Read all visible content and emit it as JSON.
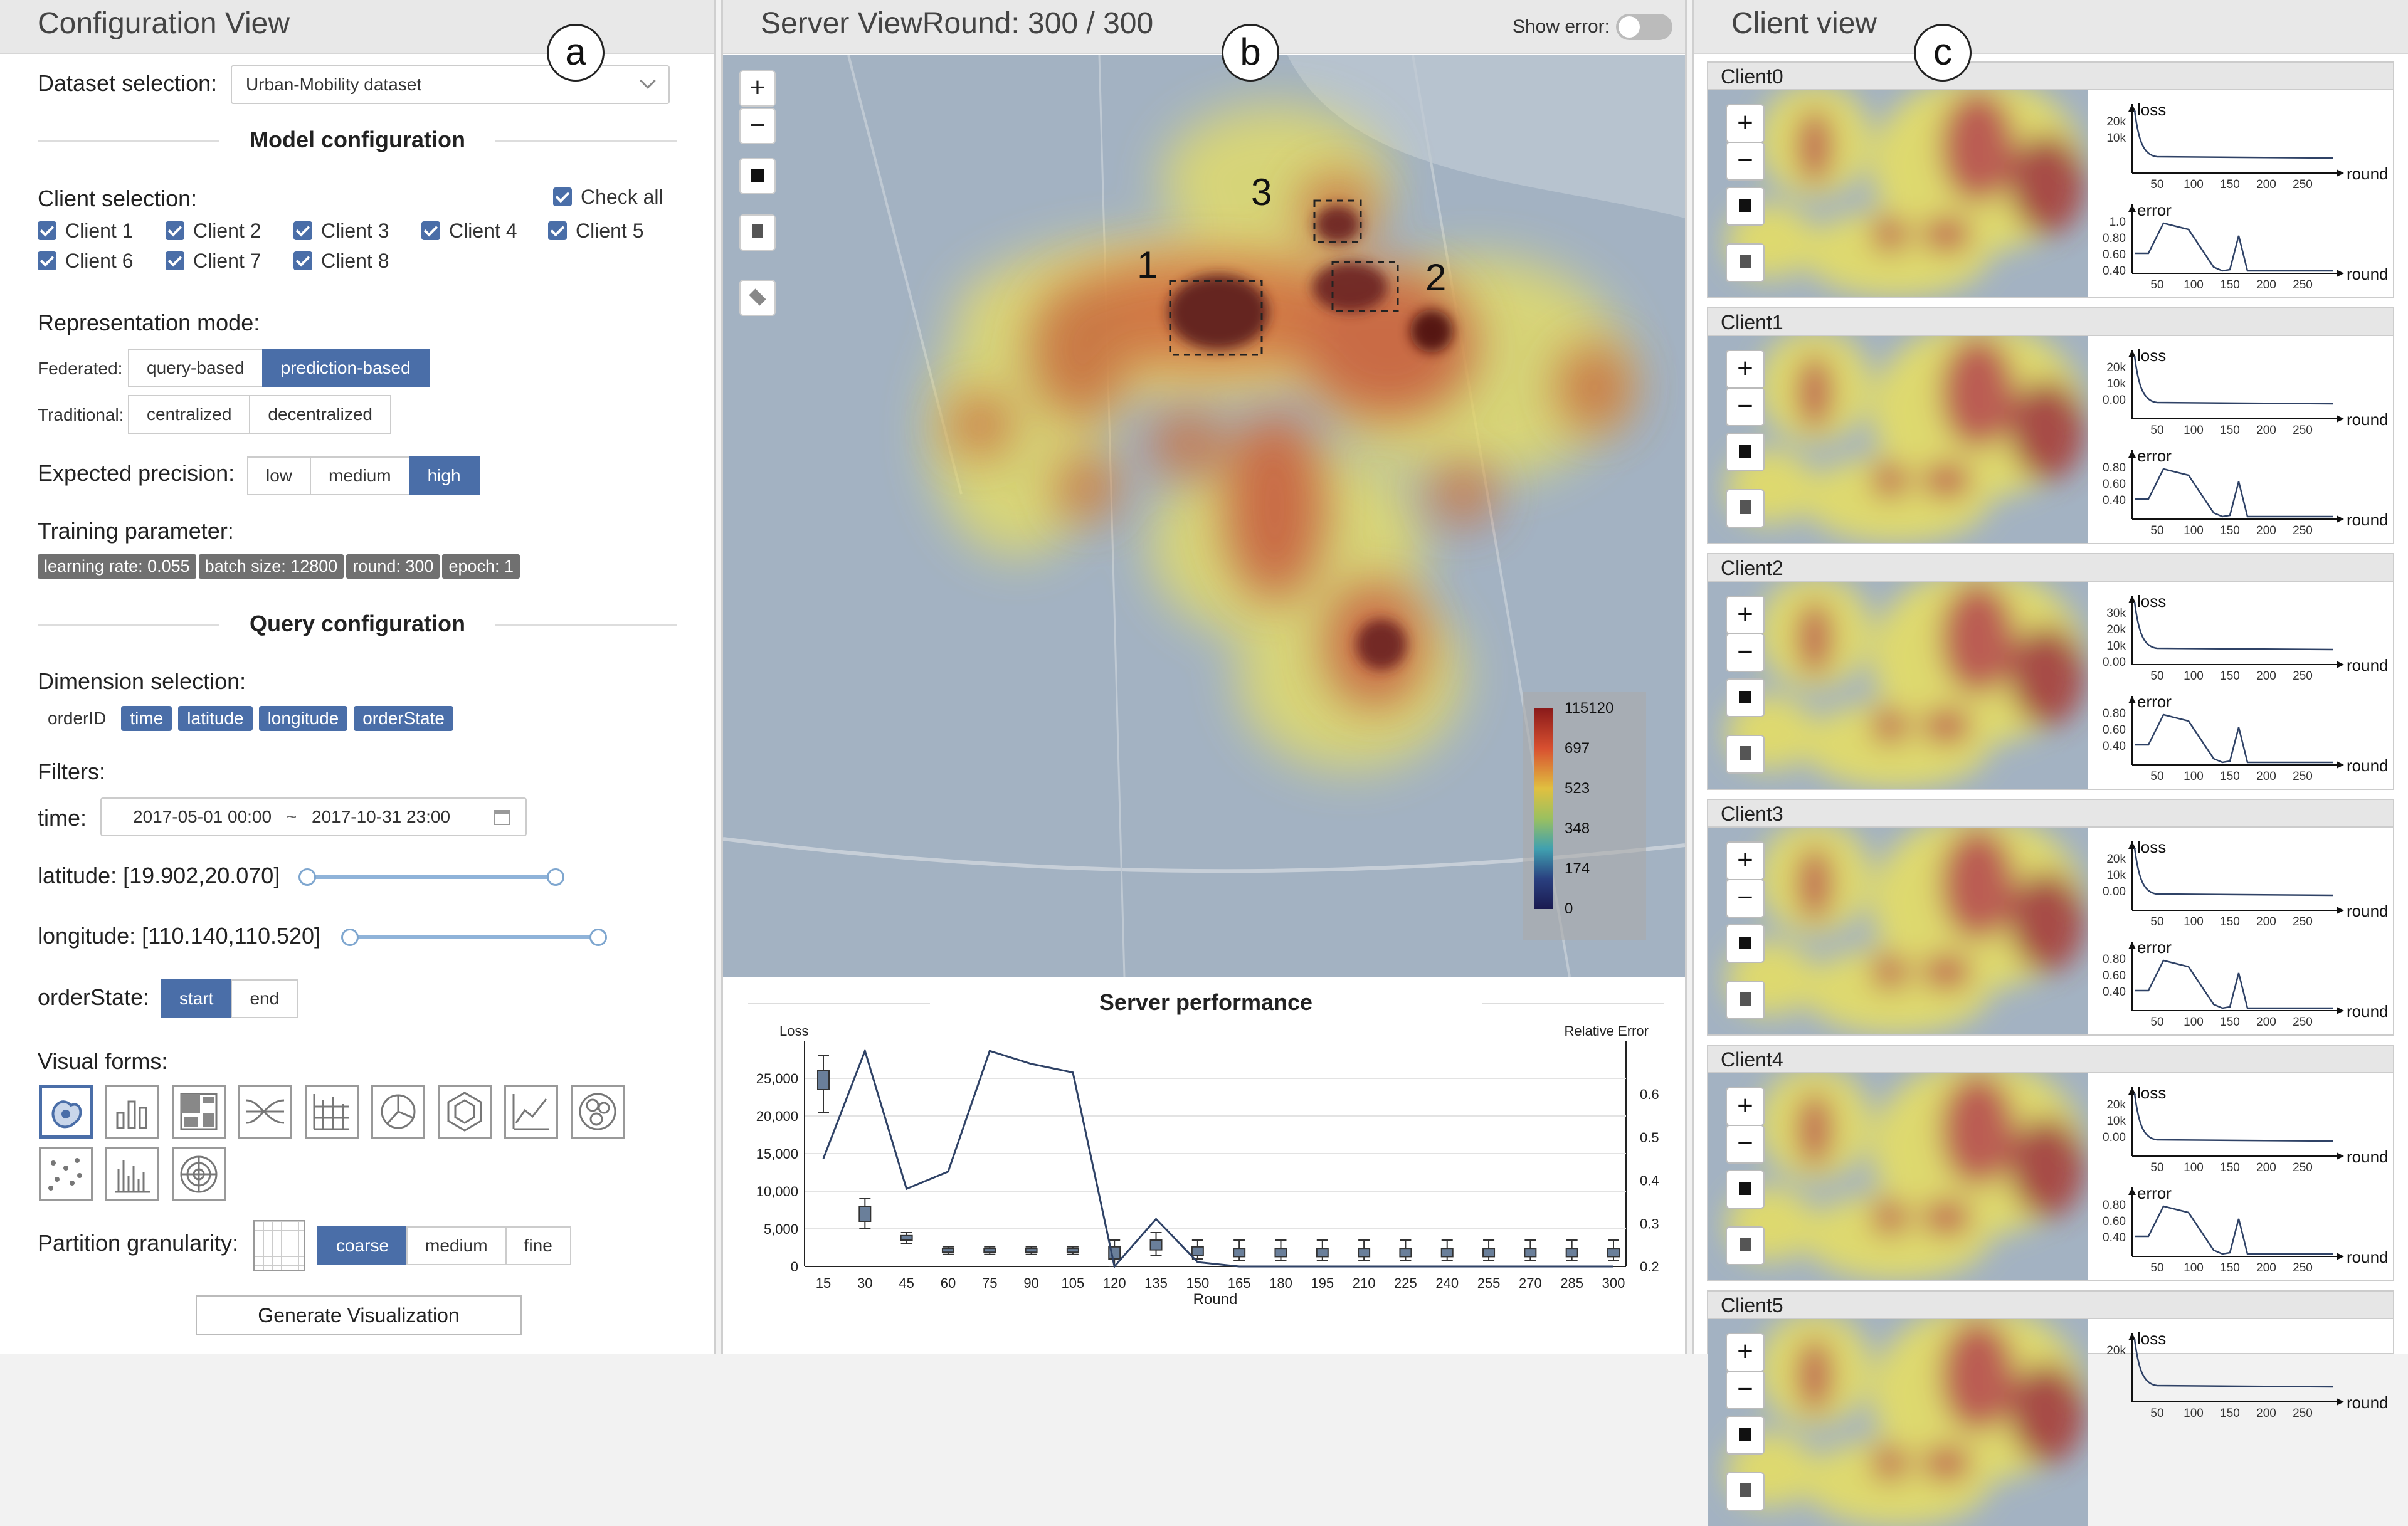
{
  "config": {
    "title": "Configuration View",
    "badge": "a",
    "dataset_label": "Dataset selection:",
    "dataset_value": "Urban-Mobility dataset",
    "model_title": "Model configuration",
    "client_label": "Client selection:",
    "check_all": "Check all",
    "clients": [
      "Client 1",
      "Client 2",
      "Client 3",
      "Client 4",
      "Client 5",
      "Client 6",
      "Client 7",
      "Client 8"
    ],
    "rep_label": "Representation mode:",
    "federated_label": "Federated:",
    "federated_opts": [
      "query-based",
      "prediction-based"
    ],
    "traditional_label": "Traditional:",
    "traditional_opts": [
      "centralized",
      "decentralized"
    ],
    "precision_label": "Expected precision:",
    "precision_opts": [
      "low",
      "medium",
      "high"
    ],
    "train_label": "Training parameter:",
    "train_tags": [
      "learning rate: 0.055",
      "batch size: 12800",
      "round: 300",
      "epoch: 1"
    ],
    "query_title": "Query configuration",
    "dim_label": "Dimension selection:",
    "dims": [
      "orderID",
      "time",
      "latitude",
      "longitude",
      "orderState"
    ],
    "filters_label": "Filters:",
    "time_label": "time:",
    "time_start": "2017-05-01 00:00",
    "time_sep": "~",
    "time_end": "2017-10-31 23:00",
    "lat_label": "latitude:  [19.902,20.070]",
    "lon_label": "longitude:  [110.140,110.520]",
    "state_label": "orderState:",
    "state_opts": [
      "start",
      "end"
    ],
    "visual_label": "Visual forms:",
    "visual_icons": [
      "blob-map-icon",
      "bar-chart-icon",
      "treemap-icon",
      "parallel-lines-icon",
      "grid-chart-icon",
      "pie-chart-icon",
      "hexagon-icon",
      "line-chart-icon",
      "bubble-icon",
      "scatter-icon",
      "histogram-icon",
      "radial-icon"
    ],
    "partition_label": "Partition granularity:",
    "partition_opts": [
      "coarse",
      "medium",
      "fine"
    ],
    "generate": "Generate Visualization"
  },
  "server": {
    "title": "Server ViewRound: 300 / 300",
    "badge": "b",
    "show_error": "Show error:",
    "regions": [
      "1",
      "2",
      "3"
    ],
    "legend": [
      "115120",
      "697",
      "523",
      "348",
      "174",
      "0"
    ],
    "perf_title": "Server performance"
  },
  "client_view": {
    "title": "Client view",
    "badge": "c",
    "clients": [
      "Client0",
      "Client1",
      "Client2",
      "Client3",
      "Client4",
      "Client5"
    ],
    "loss_label": "loss",
    "error_label": "error",
    "round_label": "round",
    "xticks": [
      "50",
      "100",
      "150",
      "200",
      "250"
    ],
    "loss_ticks": [
      [
        "20k",
        "10k"
      ],
      [
        "20k",
        "10k",
        "0.00"
      ],
      [
        "30k",
        "20k",
        "10k",
        "0.00"
      ],
      [
        "20k",
        "10k",
        "0.00"
      ],
      [
        "20k",
        "10k",
        "0.00"
      ],
      [
        "20k"
      ]
    ],
    "error_ticks": [
      [
        "1.0",
        "0.80",
        "0.60",
        "0.40"
      ],
      [
        "0.80",
        "0.60",
        "0.40"
      ],
      [
        "0.80",
        "0.60",
        "0.40"
      ],
      [
        "0.80",
        "0.60",
        "0.40"
      ],
      [
        "0.80",
        "0.60",
        "0.40"
      ]
    ]
  },
  "chart_data": {
    "type": "line",
    "title": "Server performance",
    "xlabel": "Round",
    "ylabel": "Loss",
    "y2label": "Relative Error",
    "categories": [
      15,
      30,
      45,
      60,
      75,
      90,
      105,
      120,
      135,
      150,
      165,
      180,
      195,
      210,
      225,
      240,
      255,
      270,
      285,
      300
    ],
    "ylim": [
      0,
      27500
    ],
    "yticks": [
      "25,000",
      "20,000",
      "15,000",
      "10,000",
      "5,000",
      "0"
    ],
    "y2lim": [
      0.2,
      0.68
    ],
    "y2ticks": [
      "0.6",
      "0.5",
      "0.4",
      "0.3",
      "0.2"
    ],
    "error_series": [
      0.45,
      0.7,
      0.38,
      0.42,
      0.7,
      0.67,
      0.65,
      0.2,
      0.31,
      0.21,
      0.2,
      0.2,
      0.2,
      0.2,
      0.2,
      0.2,
      0.2,
      0.2,
      0.2,
      0.2
    ],
    "loss_box": [
      [
        20500,
        23500,
        25000,
        26000,
        28000
      ],
      [
        5000,
        6000,
        7500,
        8000,
        9000
      ],
      [
        3000,
        3500,
        3800,
        4100,
        4500
      ],
      [
        1600,
        1900,
        2200,
        2400,
        2600
      ],
      [
        1600,
        1900,
        2200,
        2400,
        2600
      ],
      [
        1600,
        1900,
        2200,
        2400,
        2600
      ],
      [
        1600,
        1900,
        2200,
        2400,
        2600
      ],
      [
        0,
        1000,
        1800,
        2600,
        3500
      ],
      [
        1500,
        2200,
        2800,
        3500,
        4500
      ],
      [
        1000,
        1500,
        2000,
        2600,
        3500
      ],
      [
        800,
        1300,
        1800,
        2400,
        3500
      ],
      [
        800,
        1300,
        1800,
        2400,
        3500
      ],
      [
        800,
        1300,
        1800,
        2400,
        3500
      ],
      [
        800,
        1300,
        1800,
        2400,
        3500
      ],
      [
        800,
        1300,
        1800,
        2400,
        3500
      ],
      [
        800,
        1300,
        1800,
        2400,
        3500
      ],
      [
        800,
        1300,
        1800,
        2400,
        3500
      ],
      [
        800,
        1300,
        1800,
        2400,
        3500
      ],
      [
        800,
        1300,
        1800,
        2400,
        3500
      ],
      [
        800,
        1300,
        1800,
        2400,
        3500
      ]
    ]
  }
}
